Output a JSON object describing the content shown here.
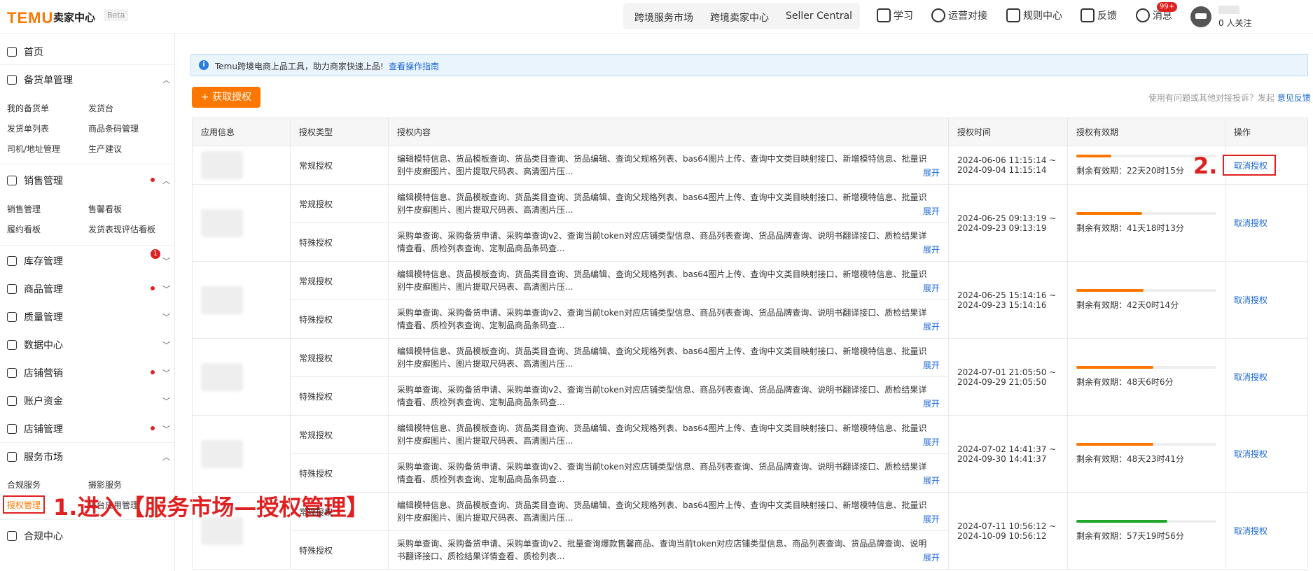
{
  "topbar": {
    "logo": "TEMU",
    "subtitle": "卖家中心",
    "beta": "Beta",
    "nav": [
      "跨境服务市场",
      "跨境卖家中心",
      "Seller Central"
    ],
    "tools": [
      "学习",
      "运营对接",
      "规则中心",
      "反馈",
      "消息"
    ],
    "message_badge": "99+",
    "follow": "0 人关注"
  },
  "sidebar": {
    "home": "首页",
    "stock": {
      "label": "备货单管理",
      "items": [
        "我的备货单",
        "发货台",
        "发货单列表",
        "商品条码管理",
        "司机/地址管理",
        "生产建议"
      ]
    },
    "sales": {
      "label": "销售管理",
      "items": [
        "销售管理",
        "售馨看板",
        "履约看板",
        "发货表现评估看板"
      ],
      "badge": "1"
    },
    "inventory": "库存管理",
    "product": "商品管理",
    "quality": "质量管理",
    "data": "数据中心",
    "marketing": "店铺营销",
    "account": "账户资金",
    "shop": "店铺管理",
    "service": {
      "label": "服务市场",
      "items": [
        "合规服务",
        "摄影服务",
        "授权管理",
        "平台应用管理"
      ]
    },
    "compliance": "合规中心"
  },
  "annotations": {
    "step1": "1.进入【服务市场—授权管理】",
    "step2": "2."
  },
  "notice": {
    "text": "Temu跨境电商上品工具，助力商家快速上品!",
    "link": "查看操作指南"
  },
  "actions": {
    "get_auth": "+ 获取授权",
    "feedback_prefix": "使用有问题或其他对接投诉？发起",
    "feedback_link": "意见反馈"
  },
  "table": {
    "headers": [
      "应用信息",
      "授权类型",
      "授权内容",
      "授权时间",
      "授权有效期",
      "操作"
    ],
    "expand": "展开",
    "cancel": "取消授权",
    "remaining_prefix": "剩余有效期：",
    "type_regular": "常规授权",
    "type_special": "特殊授权",
    "content_regular": "编辑模特信息、货品模板查询、货品类目查询、货品编辑、查询父规格列表、bas64图片上传、查询中文类目映射接口、新增模特信息、批量识别牛皮癣图片、图片提取尺码表、高清图片压...",
    "content_special": "采购单查询、采购备货申请、采购单查询v2、查询当前token对应店铺类型信息、商品列表查询、货品品牌查询、说明书翻译接口、质检结果详情查看、质检列表查询、定制品商品条码查...",
    "content_special_last": "采购单查询、采购备货申请、采购单查询v2、批量查询爆款售馨商品、查询当前token对应店铺类型信息、商品列表查询、货品品牌查询、说明书翻译接口、质检结果详情查看、质检列表...",
    "groups": [
      {
        "start": "2024-06-06 11:15:14 ~",
        "end": "2024-09-04 11:15:14",
        "remaining": "22天20时15分",
        "progress": 0.25,
        "special": false
      },
      {
        "start": "2024-06-25 09:13:19 ~",
        "end": "2024-09-23 09:13:19",
        "remaining": "41天18时13分",
        "progress": 0.47,
        "special": true
      },
      {
        "start": "2024-06-25 15:14:16 ~",
        "end": "2024-09-23 15:14:16",
        "remaining": "42天0时14分",
        "progress": 0.48,
        "special": true
      },
      {
        "start": "2024-07-01 21:05:50 ~",
        "end": "2024-09-29 21:05:50",
        "remaining": "48天6时6分",
        "progress": 0.55,
        "special": true
      },
      {
        "start": "2024-07-02 14:41:37 ~",
        "end": "2024-09-30 14:41:37",
        "remaining": "48天23时41分",
        "progress": 0.55,
        "special": true
      },
      {
        "start": "2024-07-11 10:56:12 ~",
        "end": "2024-10-09 10:56:12",
        "remaining": "57天19时56分",
        "progress": 0.65,
        "special": true,
        "green": true
      }
    ]
  }
}
